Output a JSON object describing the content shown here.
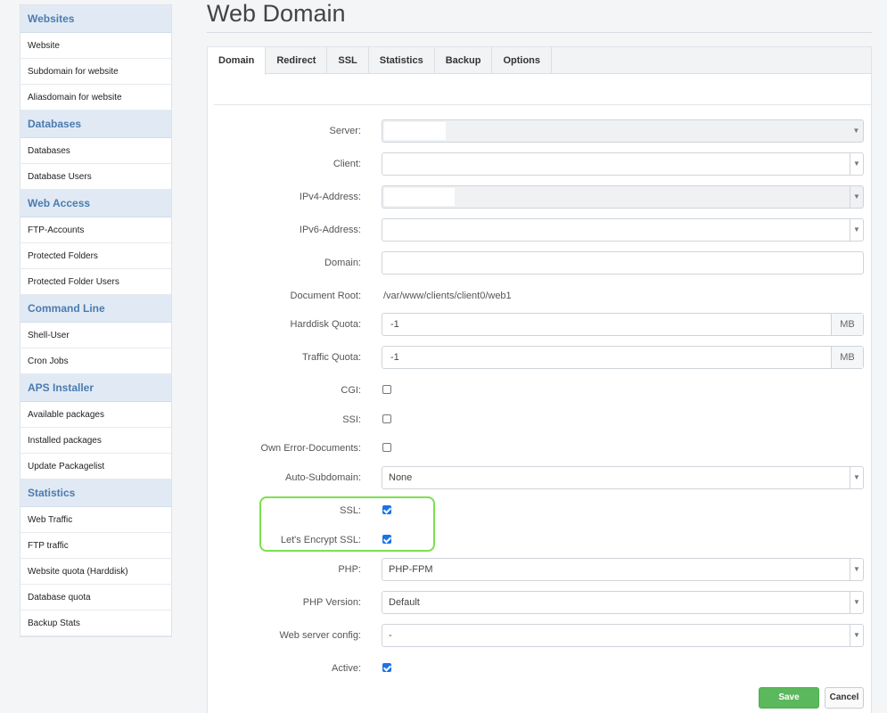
{
  "sidebar": {
    "groups": [
      {
        "title": "Websites",
        "items": [
          "Website",
          "Subdomain for website",
          "Aliasdomain for website"
        ]
      },
      {
        "title": "Databases",
        "items": [
          "Databases",
          "Database Users"
        ]
      },
      {
        "title": "Web Access",
        "items": [
          "FTP-Accounts",
          "Protected Folders",
          "Protected Folder Users"
        ]
      },
      {
        "title": "Command Line",
        "items": [
          "Shell-User",
          "Cron Jobs"
        ]
      },
      {
        "title": "APS Installer",
        "items": [
          "Available packages",
          "Installed packages",
          "Update Packagelist"
        ]
      },
      {
        "title": "Statistics",
        "items": [
          "Web Traffic",
          "FTP traffic",
          "Website quota (Harddisk)",
          "Database quota",
          "Backup Stats"
        ]
      }
    ]
  },
  "page": {
    "title": "Web Domain"
  },
  "tabs": [
    "Domain",
    "Redirect",
    "SSL",
    "Statistics",
    "Backup",
    "Options"
  ],
  "form": {
    "server": {
      "label": "Server:",
      "value": ""
    },
    "client": {
      "label": "Client:",
      "value": ""
    },
    "ipv4": {
      "label": "IPv4-Address:",
      "value": ""
    },
    "ipv6": {
      "label": "IPv6-Address:",
      "value": ""
    },
    "domain": {
      "label": "Domain:",
      "value": ""
    },
    "docroot": {
      "label": "Document Root:",
      "value": "/var/www/clients/client0/web1"
    },
    "hdquota": {
      "label": "Harddisk Quota:",
      "value": "-1",
      "unit": "MB"
    },
    "trafficquota": {
      "label": "Traffic Quota:",
      "value": "-1",
      "unit": "MB"
    },
    "cgi": {
      "label": "CGI:",
      "checked": false
    },
    "ssi": {
      "label": "SSI:",
      "checked": false
    },
    "errordocs": {
      "label": "Own Error-Documents:",
      "checked": false
    },
    "autosub": {
      "label": "Auto-Subdomain:",
      "value": "None"
    },
    "ssl": {
      "label": "SSL:",
      "checked": true
    },
    "letsencrypt": {
      "label": "Let's Encrypt SSL:",
      "checked": true
    },
    "php": {
      "label": "PHP:",
      "value": "PHP-FPM"
    },
    "phpversion": {
      "label": "PHP Version:",
      "value": "Default"
    },
    "webserverconfig": {
      "label": "Web server config:",
      "value": "-"
    },
    "active": {
      "label": "Active:",
      "checked": true
    }
  },
  "buttons": {
    "save": "Save",
    "cancel": "Cancel"
  },
  "colors": {
    "highlight": "#7ce04f",
    "save": "#5cb85c",
    "checkbox": "#1a73e8",
    "sidebar_group": "#e1eaf4"
  }
}
